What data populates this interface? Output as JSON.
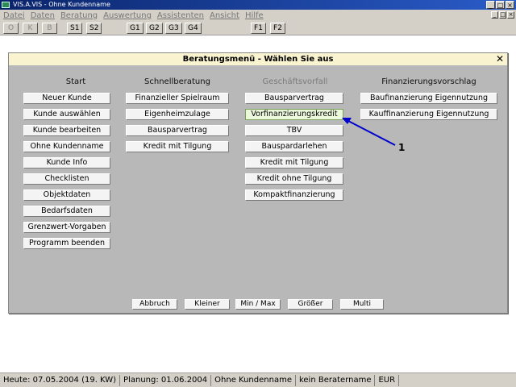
{
  "window": {
    "title": "VIS.A.VIS - Ohne Kundenname",
    "minimize": "_",
    "maximize": "□",
    "close": "×"
  },
  "menu": [
    "Datei",
    "Daten",
    "Beratung",
    "Auswertung",
    "Assistenten",
    "Ansicht",
    "Hilfe"
  ],
  "toolbar": [
    "O",
    "K",
    "B",
    "S1",
    "S2",
    "G1",
    "G2",
    "G3",
    "G4",
    "F1",
    "F2"
  ],
  "dialog": {
    "title": "Beratungsmenü - Wählen Sie aus",
    "close": "✕",
    "columns": [
      {
        "header": "Start",
        "buttons": [
          "Neuer Kunde",
          "Kunde auswählen",
          "Kunde bearbeiten",
          "Ohne Kundenname",
          "Kunde Info",
          "Checklisten",
          "Objektdaten",
          "Bedarfsdaten",
          "Grenzwert-Vorgaben",
          "Programm beenden"
        ]
      },
      {
        "header": "Schnellberatung",
        "buttons": [
          "Finanzieller Spielraum",
          "Eigenheimzulage",
          "Bausparvertrag",
          "Kredit mit Tilgung"
        ]
      },
      {
        "header": "Geschäftsvorfall",
        "buttons": [
          "Bausparvertrag",
          "Vorfinanzierungskredit",
          "TBV",
          "Bauspardarlehen",
          "Kredit mit Tilgung",
          "Kredit ohne Tilgung",
          "Kompaktfinanzierung"
        ]
      },
      {
        "header": "Finanzierungsvorschlag",
        "buttons": [
          "Baufinanzierung Eigennutzung",
          "Kauffinanzierung Eigennutzung"
        ]
      }
    ],
    "bottom_buttons": [
      "Abbruch",
      "Kleiner",
      "Min / Max",
      "Größer",
      "Multi"
    ]
  },
  "annotation": {
    "label": "1",
    "color": "#0000cc"
  },
  "status": [
    "Heute: 07.05.2004 (19. KW)",
    "Planung: 01.06.2004",
    "Ohne Kundenname",
    "kein Beratername",
    "EUR"
  ]
}
